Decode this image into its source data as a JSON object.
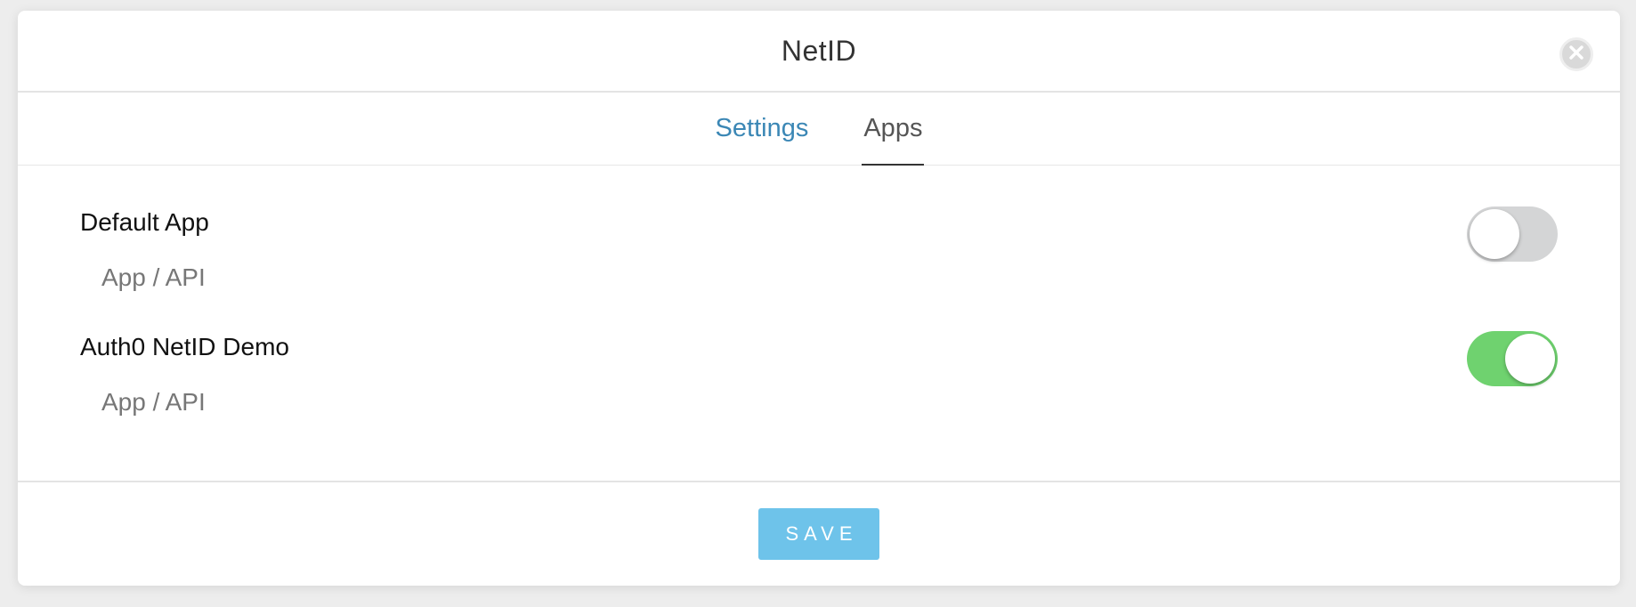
{
  "modal": {
    "title": "NetID",
    "close_icon": "close-icon"
  },
  "tabs": [
    {
      "label": "Settings",
      "active": false
    },
    {
      "label": "Apps",
      "active": true
    }
  ],
  "apps": [
    {
      "name": "Default App",
      "type": "App / API",
      "enabled": false
    },
    {
      "name": "Auth0 NetID Demo",
      "type": "App / API",
      "enabled": true
    }
  ],
  "footer": {
    "save_label": "SAVE"
  },
  "colors": {
    "accent_link": "#3b87b5",
    "toggle_on": "#6fd26f",
    "toggle_off": "#d4d5d6",
    "save_button": "#6ec3ea"
  }
}
